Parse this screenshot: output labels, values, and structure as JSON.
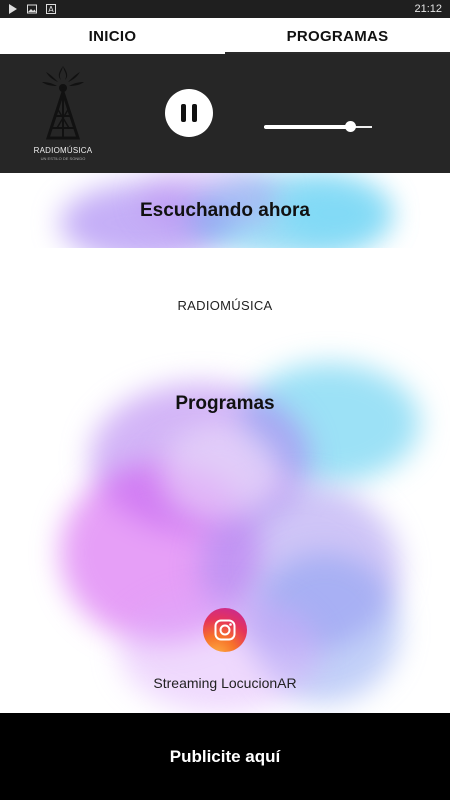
{
  "status_bar": {
    "time": "21:12",
    "icons": [
      "play-store-icon",
      "image-icon",
      "text-a-icon"
    ]
  },
  "tabs": [
    {
      "label": "INICIO",
      "active": false
    },
    {
      "label": "PROGRAMAS",
      "active": true
    }
  ],
  "player": {
    "logo_text": "RADIOMÚSICA",
    "logo_subtext": "UN ESTILO DE SONIDO",
    "state": "playing",
    "volume": 0.8
  },
  "now_playing": {
    "title": "Escuchando ahora",
    "station": "RADIOMÚSICA"
  },
  "programs": {
    "title": "Programas",
    "items": [
      {
        "icon": "instagram-icon",
        "label": "Streaming LocucionAR"
      }
    ]
  },
  "footer": {
    "label": "Publicite aquí"
  },
  "colors": {
    "player_bg": "#262626",
    "footer_bg": "#000000",
    "watercolor_blue": "#5ec8f0",
    "watercolor_purple": "#a06af0",
    "watercolor_pink": "#d84ef0"
  }
}
